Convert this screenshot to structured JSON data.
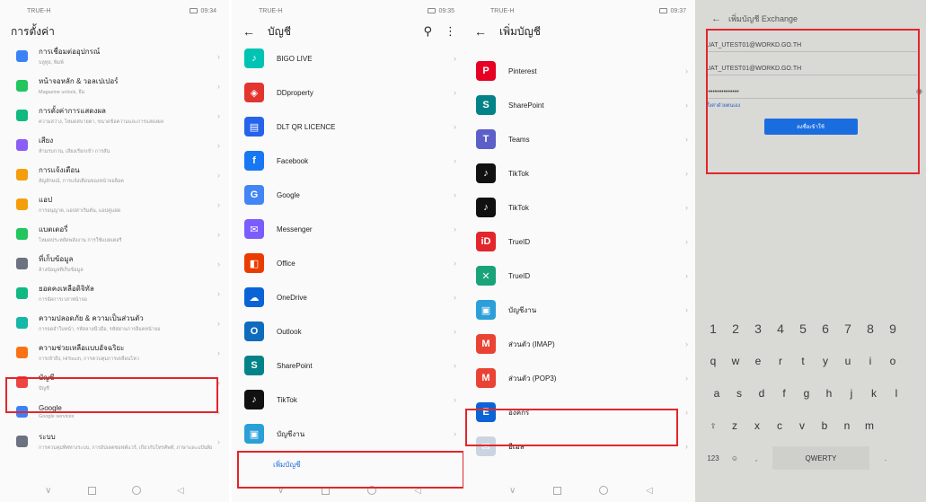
{
  "panel1": {
    "status_left": "TRUE-H",
    "status_right": "09:34",
    "title": "การตั้งค่า",
    "rows": [
      {
        "title": "การเชื่อมต่ออุปกรณ์",
        "sub": "บลูทูธ, พิมพ์",
        "color": "#3b82f6"
      },
      {
        "title": "หน้าจอหลัก & วอลเปเปอร์",
        "sub": "Magazine unlock, ธีม",
        "color": "#22c55e"
      },
      {
        "title": "การตั้งค่าการแสดงผล",
        "sub": "ความสว่าง, โหมดสบายตา, ขนาดข้อความและการแสดงผล",
        "color": "#10b981"
      },
      {
        "title": "เสียง",
        "sub": "ห้ามรบกวน, เสียงเรียกเข้า การสั่น",
        "color": "#8b5cf6"
      },
      {
        "title": "การแจ้งเตือน",
        "sub": "สัญลักษณ์, การแจ้งเตือนของหน้าจอล็อค",
        "color": "#f59e0b"
      },
      {
        "title": "แอป",
        "sub": "การอนุญาต, แอปค่าเริ่มต้น, แอปคู่แฝด",
        "color": "#f59e0b"
      },
      {
        "title": "แบตเตอรี่",
        "sub": "โหมดประหยัดพลังงาน การใช้แบตเตอรี่",
        "color": "#22c55e"
      },
      {
        "title": "ที่เก็บข้อมูล",
        "sub": "ล้างข้อมูลที่เก็บข้อมูล",
        "color": "#6b7280"
      },
      {
        "title": "ยอดคงเหลือดิจิทัล",
        "sub": "การจัดการเวลาหน้าจอ",
        "color": "#10b981"
      },
      {
        "title": "ความปลอดภัย & ความเป็นส่วนตัว",
        "sub": "การจดจำใบหน้า, รหัสลายนิ้วมือ, รหัสผ่านการล็อคหน้าจอ",
        "color": "#14b8a6"
      },
      {
        "title": "ความช่วยเหลือแบบอัจฉริยะ",
        "sub": "การเข้าถึง, HiTouch, การควบคุมการเคลื่อนไหว",
        "color": "#f97316"
      },
      {
        "title": "บัญชี",
        "sub": "บัญชี",
        "color": "#ef4444"
      },
      {
        "title": "Google",
        "sub": "Google services",
        "color": "#3b82f6"
      },
      {
        "title": "ระบบ",
        "sub": "การควบคุมทิศทางระบบ, การอัปเดตซอฟต์แวร์, เกี่ยวกับโทรศัพท์, ภาษาและแป้นพิมพ์",
        "color": "#6b7280"
      }
    ]
  },
  "panel2": {
    "status_left": "TRUE-H",
    "status_right": "09:35",
    "title": "บัญชี",
    "items": [
      {
        "label": "BIGO LIVE",
        "icon": "bigo-icon",
        "color": "#00c4b3",
        "glyph": "♪"
      },
      {
        "label": "DDproperty",
        "icon": "ddproperty-icon",
        "color": "#e3342f",
        "glyph": "◈"
      },
      {
        "label": "DLT QR LICENCE",
        "icon": "dlt-icon",
        "color": "#2563eb",
        "glyph": "▤"
      },
      {
        "label": "Facebook",
        "icon": "facebook-icon",
        "color": "#1877f2",
        "glyph": "f"
      },
      {
        "label": "Google",
        "icon": "google-icon",
        "color": "#4285f4",
        "glyph": "G"
      },
      {
        "label": "Messenger",
        "icon": "messenger-icon",
        "color": "#7b5cff",
        "glyph": "✉"
      },
      {
        "label": "Office",
        "icon": "office-icon",
        "color": "#eb3c00",
        "glyph": "◧"
      },
      {
        "label": "OneDrive",
        "icon": "onedrive-icon",
        "color": "#0a64d6",
        "glyph": "☁"
      },
      {
        "label": "Outlook",
        "icon": "outlook-icon",
        "color": "#0f6cbd",
        "glyph": "O"
      },
      {
        "label": "SharePoint",
        "icon": "sharepoint-icon",
        "color": "#038387",
        "glyph": "S"
      },
      {
        "label": "TikTok",
        "icon": "tiktok-icon",
        "color": "#111111",
        "glyph": "♪"
      },
      {
        "label": "บัญชีงาน",
        "icon": "work-account-icon",
        "color": "#2b9fd8",
        "glyph": "▣"
      }
    ],
    "add_account": "เพิ่มบัญชี"
  },
  "panel3": {
    "status_left": "TRUE-H",
    "status_right": "09:37",
    "title": "เพิ่มบัญชี",
    "items": [
      {
        "label": "Pinterest",
        "icon": "pinterest-icon",
        "color": "#e60023",
        "glyph": "P"
      },
      {
        "label": "SharePoint",
        "icon": "sharepoint-icon",
        "color": "#038387",
        "glyph": "S"
      },
      {
        "label": "Teams",
        "icon": "teams-icon",
        "color": "#5b5fc7",
        "glyph": "T"
      },
      {
        "label": "TikTok",
        "icon": "tiktok-icon",
        "color": "#111111",
        "glyph": "♪"
      },
      {
        "label": "TikTok",
        "icon": "tiktok-icon",
        "color": "#111111",
        "glyph": "♪"
      },
      {
        "label": "TrueID",
        "icon": "trueid-icon",
        "color": "#e3262b",
        "glyph": "iD"
      },
      {
        "label": "TrueID",
        "icon": "trueid-icon",
        "color": "#1aa37a",
        "glyph": "✕"
      },
      {
        "label": "บัญชีงาน",
        "icon": "work-account-icon",
        "color": "#2b9fd8",
        "glyph": "▣"
      },
      {
        "label": "ส่วนตัว (IMAP)",
        "icon": "gmail-icon",
        "color": "#ea4335",
        "glyph": "M"
      },
      {
        "label": "ส่วนตัว (POP3)",
        "icon": "gmail-icon",
        "color": "#ea4335",
        "glyph": "M"
      },
      {
        "label": "องค์กร",
        "icon": "exchange-icon",
        "color": "#0a64d6",
        "glyph": "E"
      },
      {
        "label": "อีเมล",
        "icon": "email-icon",
        "color": "#cbd5e1",
        "glyph": "✉"
      }
    ]
  },
  "panel4": {
    "title": "เพิ่มบัญชี Exchange",
    "email": "UAT_UTEST01@WORKD.GO.TH",
    "username": "UAT_UTEST01@WORKD.GO.TH",
    "password": "•••••••••••••••",
    "manual_setup": "ตั้งค่าด้วยตนเอง",
    "sign_in": "ลงชื่อเข้าใช้",
    "keyboard": {
      "nums": [
        "1",
        "2",
        "3",
        "4",
        "5",
        "6",
        "7",
        "8",
        "9"
      ],
      "row1": [
        "q",
        "w",
        "e",
        "r",
        "t",
        "y",
        "u",
        "i",
        "o"
      ],
      "row2": [
        "a",
        "s",
        "d",
        "f",
        "g",
        "h",
        "j",
        "k",
        "l"
      ],
      "row3": [
        "z",
        "x",
        "c",
        "v",
        "b",
        "n",
        "m"
      ],
      "fn_left": "123",
      "space": "QWERTY"
    }
  }
}
